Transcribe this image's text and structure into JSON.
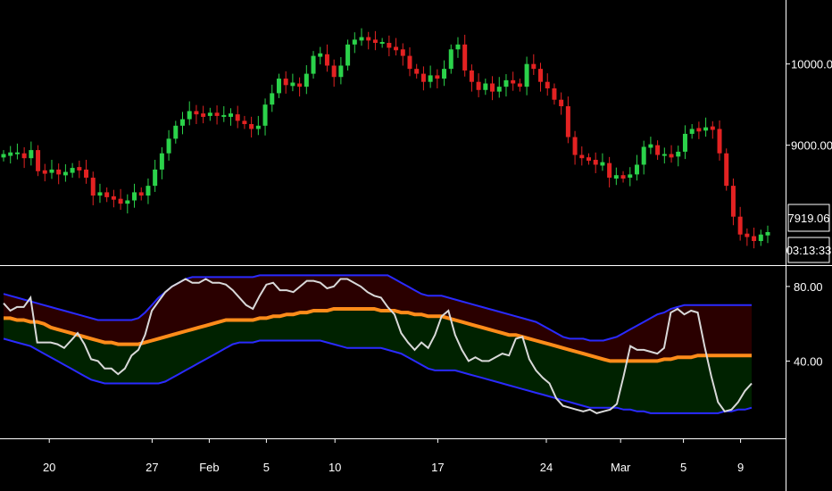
{
  "chart_data": [
    {
      "type": "candlestick",
      "panel": "price",
      "colors": {
        "up": "#2bd24a",
        "down": "#e32222",
        "background": "#000000",
        "axis": "#ffffff"
      },
      "y_ticks": [
        {
          "value": 10000,
          "label": "10000.00"
        },
        {
          "value": 9000,
          "label": "9000.00"
        }
      ],
      "ylim": [
        7600,
        10700
      ],
      "last_price": {
        "value": 7919.06,
        "label": "7919.06"
      },
      "countdown": "03:13:33",
      "close_series": [
        8880,
        8900,
        8900,
        8840,
        8940,
        8680,
        8660,
        8700,
        8640,
        8660,
        8720,
        8700,
        8600,
        8380,
        8420,
        8360,
        8340,
        8280,
        8320,
        8420,
        8380,
        8500,
        8700,
        8900,
        9080,
        9240,
        9320,
        9420,
        9380,
        9360,
        9400,
        9360,
        9360,
        9380,
        9300,
        9260,
        9200,
        9240,
        9500,
        9640,
        9820,
        9740,
        9760,
        9720,
        9880,
        10100,
        10120,
        9980,
        9840,
        9980,
        10240,
        10300,
        10320,
        10300,
        10260,
        10260,
        10200,
        10180,
        10100,
        9940,
        9880,
        9780,
        9860,
        9820,
        9940,
        10180,
        10240,
        9920,
        9780,
        9680,
        9760,
        9660,
        9720,
        9800,
        9760,
        9720,
        10000,
        9940,
        9780,
        9700,
        9560,
        9480,
        9100,
        8880,
        8840,
        8820,
        8760,
        8780,
        8600,
        8620,
        8600,
        8640,
        8760,
        8980,
        9000,
        8880,
        8880,
        8860,
        8920,
        9140,
        9200,
        9180,
        9220,
        9200,
        8900,
        8500,
        8120,
        7900,
        7880,
        7820,
        7900,
        7919
      ]
    },
    {
      "type": "line",
      "panel": "oscillator",
      "y_ticks": [
        {
          "value": 80,
          "label": "80.00"
        },
        {
          "value": 40,
          "label": "40.00"
        }
      ],
      "ylim": [
        0,
        90
      ],
      "colors": {
        "upper_band": "#2a2aff",
        "lower_band": "#2a2aff",
        "signal": "#ff8c1a",
        "oscillator": "#d9d9d9",
        "upper_fill": "#2a0000",
        "lower_fill": "#002200"
      },
      "series": [
        {
          "role": "oscillator",
          "values": [
            71,
            67,
            69,
            69,
            74,
            50,
            50,
            50,
            49,
            47,
            51,
            55,
            49,
            41,
            40,
            36,
            36,
            33,
            36,
            43,
            46,
            54,
            67,
            72,
            77,
            80,
            82,
            84,
            82,
            82,
            84,
            82,
            82,
            81,
            78,
            74,
            70,
            68,
            75,
            81,
            82,
            78,
            78,
            77,
            80,
            83,
            83,
            82,
            79,
            80,
            84,
            84,
            82,
            80,
            77,
            75,
            74,
            69,
            65,
            55,
            50,
            46,
            50,
            47,
            54,
            64,
            67,
            54,
            46,
            40,
            42,
            40,
            40,
            42,
            44,
            43,
            52,
            53,
            41,
            35,
            31,
            28,
            20,
            16,
            15,
            14,
            13,
            14,
            12,
            13,
            14,
            17,
            32,
            48,
            46,
            46,
            45,
            44,
            47,
            66,
            68,
            65,
            67,
            66,
            48,
            32,
            18,
            13,
            14,
            18,
            24,
            28
          ]
        },
        {
          "role": "signal",
          "values": [
            63,
            63,
            62,
            62,
            61,
            61,
            60,
            58,
            57,
            56,
            55,
            54,
            53,
            52,
            51,
            50,
            50,
            49,
            49,
            49,
            49,
            50,
            51,
            52,
            53,
            54,
            55,
            56,
            57,
            58,
            59,
            60,
            61,
            62,
            62,
            62,
            62,
            62,
            63,
            63,
            64,
            64,
            65,
            65,
            66,
            66,
            67,
            67,
            67,
            68,
            68,
            68,
            68,
            68,
            68,
            68,
            67,
            67,
            67,
            66,
            66,
            65,
            65,
            64,
            64,
            64,
            63,
            62,
            61,
            60,
            59,
            58,
            57,
            56,
            55,
            54,
            54,
            53,
            52,
            51,
            50,
            49,
            48,
            47,
            46,
            45,
            44,
            43,
            42,
            41,
            40,
            40,
            40,
            40,
            40,
            40,
            40,
            40,
            41,
            41,
            42,
            42,
            42,
            43,
            43,
            43,
            43,
            43,
            43,
            43,
            43,
            43
          ]
        },
        {
          "role": "upper_band",
          "values": [
            76,
            75,
            74,
            73,
            72,
            71,
            70,
            69,
            68,
            67,
            66,
            65,
            64,
            63,
            62,
            62,
            62,
            62,
            62,
            62,
            63,
            66,
            70,
            74,
            77,
            80,
            82,
            84,
            85,
            85,
            85,
            85,
            85,
            85,
            85,
            85,
            85,
            85,
            86,
            86,
            86,
            86,
            86,
            86,
            86,
            86,
            86,
            86,
            86,
            86,
            86,
            86,
            86,
            86,
            86,
            86,
            86,
            86,
            84,
            82,
            80,
            78,
            76,
            75,
            75,
            75,
            74,
            73,
            72,
            71,
            70,
            69,
            68,
            67,
            66,
            65,
            64,
            63,
            62,
            61,
            59,
            57,
            55,
            53,
            52,
            52,
            52,
            51,
            51,
            51,
            52,
            53,
            55,
            57,
            59,
            61,
            63,
            65,
            66,
            68,
            69,
            70,
            70,
            70,
            70,
            70,
            70,
            70,
            70,
            70,
            70,
            70
          ]
        },
        {
          "role": "lower_band",
          "values": [
            52,
            51,
            50,
            49,
            48,
            46,
            44,
            42,
            40,
            38,
            36,
            34,
            32,
            30,
            29,
            28,
            28,
            28,
            28,
            28,
            28,
            28,
            28,
            28,
            29,
            31,
            33,
            35,
            37,
            39,
            41,
            43,
            45,
            47,
            49,
            50,
            50,
            50,
            51,
            51,
            51,
            51,
            51,
            51,
            51,
            51,
            51,
            51,
            50,
            49,
            48,
            47,
            47,
            47,
            47,
            47,
            47,
            46,
            45,
            44,
            42,
            40,
            38,
            36,
            35,
            35,
            35,
            35,
            34,
            33,
            32,
            31,
            30,
            29,
            28,
            27,
            26,
            25,
            24,
            23,
            22,
            21,
            20,
            19,
            18,
            17,
            16,
            15,
            15,
            15,
            15,
            15,
            14,
            14,
            13,
            13,
            12,
            12,
            12,
            12,
            12,
            12,
            12,
            12,
            12,
            12,
            12,
            13,
            13,
            14,
            14,
            15
          ]
        }
      ]
    }
  ],
  "x_axis": {
    "ticks": [
      {
        "label": "20",
        "index": 8
      },
      {
        "label": "27",
        "index": 26
      },
      {
        "label": "Feb",
        "index": 36
      },
      {
        "label": "5",
        "index": 46
      },
      {
        "label": "10",
        "index": 58
      },
      {
        "label": "17",
        "index": 76
      },
      {
        "label": "24",
        "index": 95
      },
      {
        "label": "Mar",
        "index": 108
      },
      {
        "label": "5",
        "index": 119
      },
      {
        "label": "9",
        "index": 129
      }
    ]
  }
}
